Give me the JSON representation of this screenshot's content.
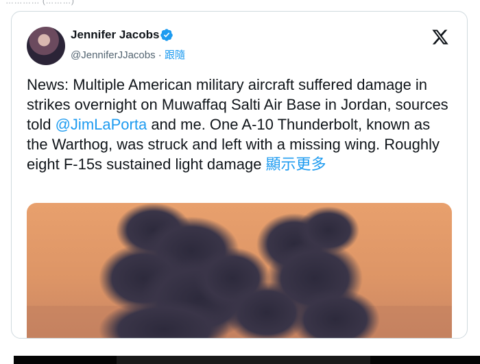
{
  "top_caption": "………… (………)",
  "tweet": {
    "author_name": "Jennifer Jacobs",
    "handle": "@JenniferJJacobs",
    "separator": " · ",
    "follow_label": "跟隨",
    "text_part1": "News: Multiple American military aircraft suffered damage in strikes overnight on Muwaffaq Salti Air Base in Jordan, sources told ",
    "mention": "@JimLaPorta",
    "text_part2": " and me. One A-10 Thunderbolt, known as the Warthog, was struck and left with a missing wing. Roughly eight F-15s sustained light damage ",
    "show_more": "顯示更多"
  },
  "icons": {
    "verified": "verified-badge-icon",
    "x_logo": "x-logo-icon"
  },
  "colors": {
    "accent": "#1d9bf0",
    "text": "#0f1419",
    "secondary": "#536471"
  }
}
